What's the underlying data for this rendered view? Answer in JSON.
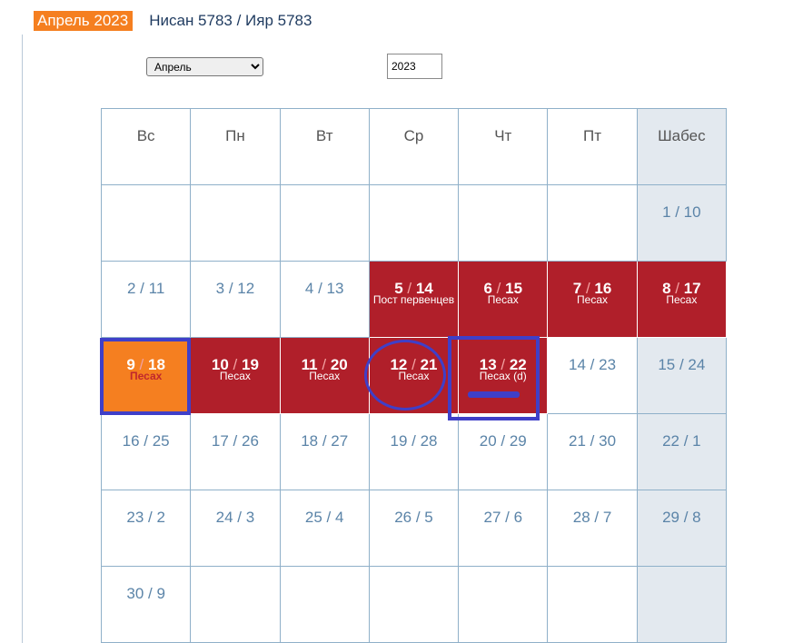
{
  "header": {
    "month_badge": "Апрель 2023",
    "hebrew_months": "Нисан 5783 / Ияр 5783"
  },
  "controls": {
    "month_select_value": "Апрель",
    "year_value": "2023"
  },
  "weekdays": [
    "Вс",
    "Пн",
    "Вт",
    "Ср",
    "Чт",
    "Пт",
    "Шабес"
  ],
  "weeks": [
    [
      {
        "label": ""
      },
      {
        "label": ""
      },
      {
        "label": ""
      },
      {
        "label": ""
      },
      {
        "label": ""
      },
      {
        "label": ""
      },
      {
        "label": "1 / 10",
        "shabbat": true
      }
    ],
    [
      {
        "label": "2 / 11"
      },
      {
        "label": "3 / 12"
      },
      {
        "label": "4 / 13"
      },
      {
        "g": "5",
        "h": "14",
        "event": "Пост первенцев",
        "holiday": true
      },
      {
        "g": "6",
        "h": "15",
        "event": "Песах",
        "holiday": true
      },
      {
        "g": "7",
        "h": "16",
        "event": "Песах",
        "holiday": true
      },
      {
        "g": "8",
        "h": "17",
        "event": "Песах",
        "holiday": true,
        "shabbat": true
      }
    ],
    [
      {
        "g": "9",
        "h": "18",
        "event": "Песах",
        "today": true
      },
      {
        "g": "10",
        "h": "19",
        "event": "Песах",
        "holiday": true
      },
      {
        "g": "11",
        "h": "20",
        "event": "Песах",
        "holiday": true
      },
      {
        "g": "12",
        "h": "21",
        "event": "Песах",
        "holiday": true
      },
      {
        "g": "13",
        "h": "22",
        "event": "Песах (d)",
        "holiday": true
      },
      {
        "label": "14 / 23"
      },
      {
        "label": "15 / 24",
        "shabbat": true
      }
    ],
    [
      {
        "label": "16 / 25"
      },
      {
        "label": "17 / 26"
      },
      {
        "label": "18 / 27"
      },
      {
        "label": "19 / 28"
      },
      {
        "label": "20 / 29"
      },
      {
        "label": "21 / 30"
      },
      {
        "label": "22 / 1",
        "shabbat": true
      }
    ],
    [
      {
        "label": "23 / 2"
      },
      {
        "label": "24 / 3"
      },
      {
        "label": "25 / 4"
      },
      {
        "label": "26 / 5"
      },
      {
        "label": "27 / 6"
      },
      {
        "label": "28 / 7"
      },
      {
        "label": "29 / 8",
        "shabbat": true
      }
    ],
    [
      {
        "label": "30 / 9"
      },
      {
        "label": ""
      },
      {
        "label": ""
      },
      {
        "label": ""
      },
      {
        "label": ""
      },
      {
        "label": ""
      },
      {
        "label": "",
        "shabbat": true
      }
    ]
  ],
  "colors": {
    "holiday_bg": "#b01f2a",
    "today_bg": "#f57f20",
    "shabbat_bg": "#e3e9ef",
    "annotation": "#3f3fc8",
    "date_text": "#5b84a8"
  }
}
